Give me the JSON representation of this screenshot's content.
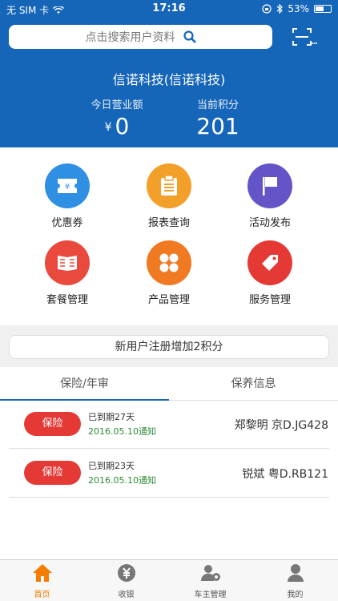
{
  "status_bar": {
    "carrier": "无 SIM 卡",
    "time": "17:16",
    "battery": "53%",
    "battery_level": 0.53
  },
  "search": {
    "placeholder": "点击搜索用户资料"
  },
  "company": {
    "name": "信诺科技(信诺科技)"
  },
  "stats": {
    "revenue": {
      "label": "今日营业额",
      "currency": "¥",
      "value": "0"
    },
    "points": {
      "label": "当前积分",
      "value": "201"
    }
  },
  "grid": {
    "items": [
      {
        "label": "优惠券",
        "icon": "coupon-icon",
        "color": "#2f8fe3"
      },
      {
        "label": "报表查询",
        "icon": "clipboard-icon",
        "color": "#f2a02a"
      },
      {
        "label": "活动发布",
        "icon": "flag-icon",
        "color": "#6355c7"
      },
      {
        "label": "套餐管理",
        "icon": "book-icon",
        "color": "#ea4a3e"
      },
      {
        "label": "产品管理",
        "icon": "grid-icon",
        "color": "#f07a22"
      },
      {
        "label": "服务管理",
        "icon": "tag-icon",
        "color": "#e53935"
      }
    ]
  },
  "banner": {
    "text": "新用户注册增加2积分"
  },
  "tabs": [
    "保险/年审",
    "保养信息"
  ],
  "records": [
    {
      "badge": "保险",
      "expire": "已到期27天",
      "notify": "2016.05.10通知",
      "owner": "郑黎明  京D.JG428"
    },
    {
      "badge": "保险",
      "expire": "已到期23天",
      "notify": "2016.05.10通知",
      "owner": "锐斌  粤D.RB121"
    }
  ],
  "tabbar": {
    "items": [
      {
        "label": "首页",
        "icon": "home-icon"
      },
      {
        "label": "收银",
        "icon": "cashier-icon"
      },
      {
        "label": "车主管理",
        "icon": "owner-manage-icon"
      },
      {
        "label": "我的",
        "icon": "profile-icon"
      }
    ],
    "active_color": "#f57c00"
  },
  "colors": {
    "primary": "#1565b9",
    "accent": "#f57c00",
    "badge": "#e53935"
  }
}
